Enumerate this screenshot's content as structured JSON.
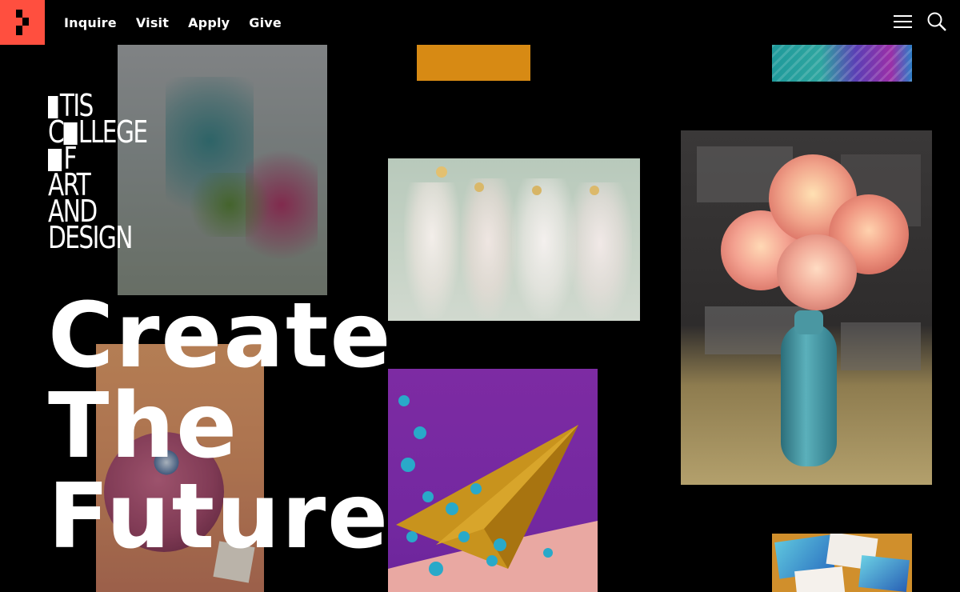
{
  "header": {
    "nav": [
      {
        "label": "Inquire"
      },
      {
        "label": "Visit"
      },
      {
        "label": "Apply"
      },
      {
        "label": "Give"
      }
    ],
    "menu_icon": "hamburger-menu-icon",
    "search_icon": "search-icon"
  },
  "brand": {
    "logo_color": "#ff4f3f",
    "wordmark_lines": [
      "TIS",
      "LLEGE",
      "F",
      "ART",
      "AND",
      "DESIGN"
    ]
  },
  "hero": {
    "headline_lines": [
      "Create",
      "The",
      "Future"
    ]
  }
}
